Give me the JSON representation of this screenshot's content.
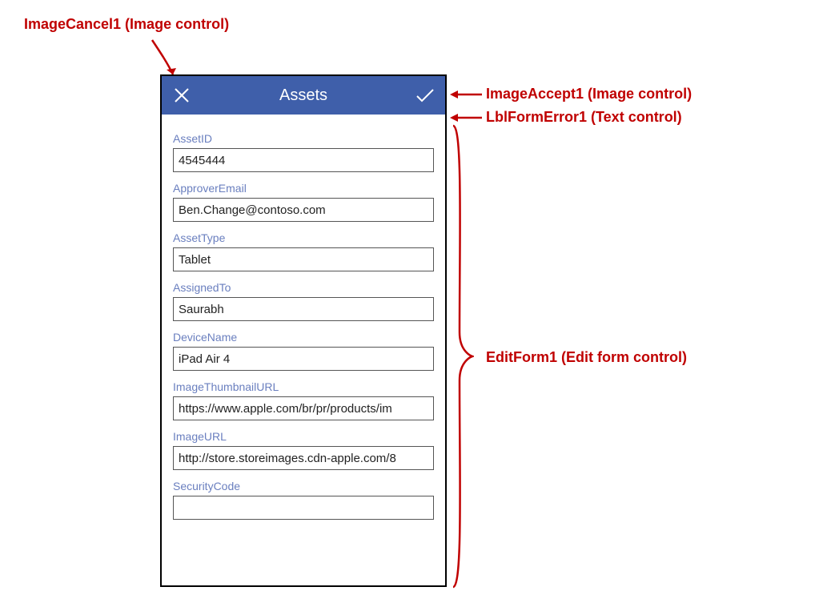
{
  "callouts": {
    "imageCancel": "ImageCancel1 (Image control)",
    "imageAccept": "ImageAccept1 (Image control)",
    "lblFormError": "LblFormError1 (Text control)",
    "editForm": "EditForm1 (Edit form control)"
  },
  "header": {
    "title": "Assets"
  },
  "form": {
    "fields": [
      {
        "label": "AssetID",
        "value": "4545444"
      },
      {
        "label": "ApproverEmail",
        "value": "Ben.Change@contoso.com"
      },
      {
        "label": "AssetType",
        "value": "Tablet"
      },
      {
        "label": "AssignedTo",
        "value": "Saurabh"
      },
      {
        "label": "DeviceName",
        "value": "iPad Air 4"
      },
      {
        "label": "ImageThumbnailURL",
        "value": "https://www.apple.com/br/pr/products/im"
      },
      {
        "label": "ImageURL",
        "value": "http://store.storeimages.cdn-apple.com/8"
      },
      {
        "label": "SecurityCode",
        "value": ""
      }
    ]
  }
}
